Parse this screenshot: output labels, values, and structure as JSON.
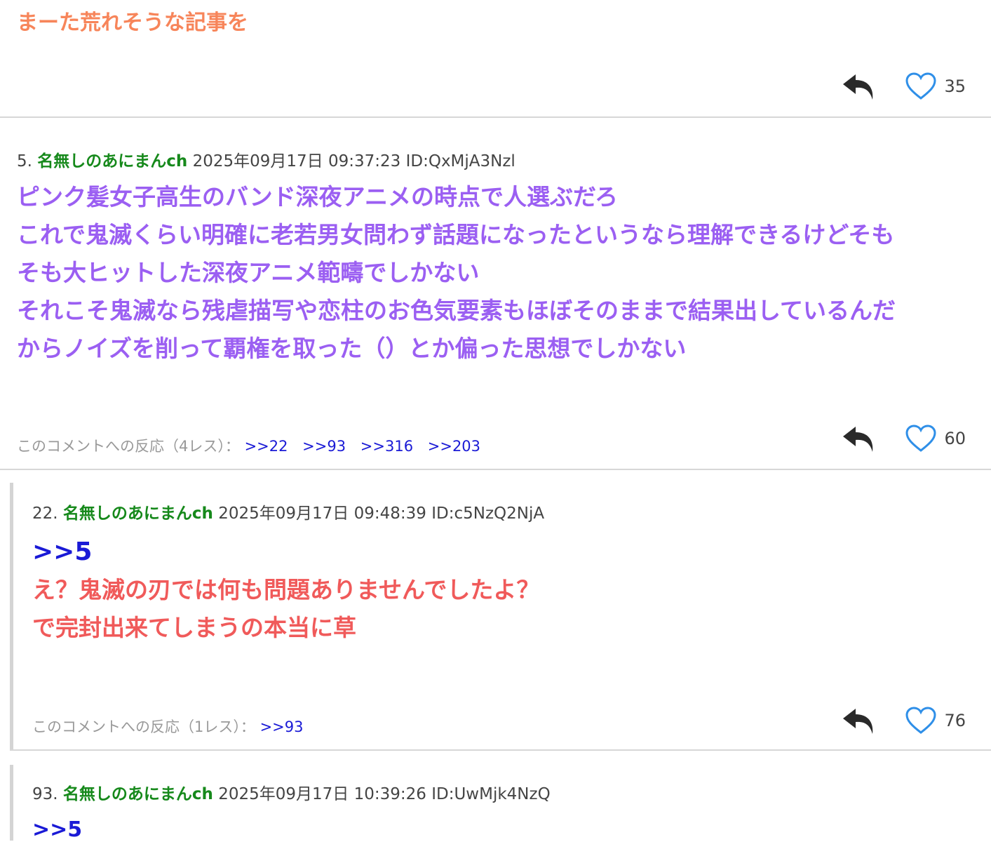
{
  "comment_prev": {
    "text": "まーた荒れそうな記事を",
    "like_count": "35",
    "color": "#f7855a"
  },
  "comment_5": {
    "number": "5.",
    "name": "名無しのあにまんch",
    "datetime": "2025年09月17日 09:37:23",
    "id": "ID:QxMjA3Nzl",
    "lines": [
      "ピンク髪女子高生のバンド深夜アニメの時点で人選ぶだろ",
      "これで鬼滅くらい明確に老若男女問わず話題になったというなら理解できるけどそも",
      "そも大ヒットした深夜アニメ範疇でしかない",
      "それこそ鬼滅なら残虐描写や恋柱のお色気要素もほぼそのままで結果出しているんだ",
      "からノイズを削って覇権を取った（）とか偏った思想でしかない"
    ],
    "color": "#9b5ff2",
    "reactions_label": "このコメントへの反応（4レス）：",
    "reactions": [
      ">>22",
      ">>93",
      ">>316",
      ">>203"
    ],
    "like_count": "60"
  },
  "comment_22": {
    "number": "22.",
    "name": "名無しのあにまんch",
    "datetime": "2025年09月17日 09:48:39",
    "id": "ID:c5NzQ2NjA",
    "anchor": ">>5",
    "lines": [
      "え？鬼滅の刃では何も問題ありませんでしたよ？",
      "で完封出来てしまうの本当に草"
    ],
    "color": "#f05a5a",
    "reactions_label": "このコメントへの反応（1レス）：",
    "reactions": [
      ">>93"
    ],
    "like_count": "76"
  },
  "comment_93": {
    "number": "93.",
    "name": "名無しのあにまんch",
    "datetime": "2025年09月17日 10:39:26",
    "id": "ID:UwMjk4NzQ",
    "anchor": ">>5"
  },
  "icons": {
    "reply": "reply-arrow-icon",
    "like": "heart-outline-icon"
  },
  "colors": {
    "name_green": "#16891b",
    "anchor_blue": "#1a1ad6",
    "heart_blue": "#2f8fe8"
  }
}
